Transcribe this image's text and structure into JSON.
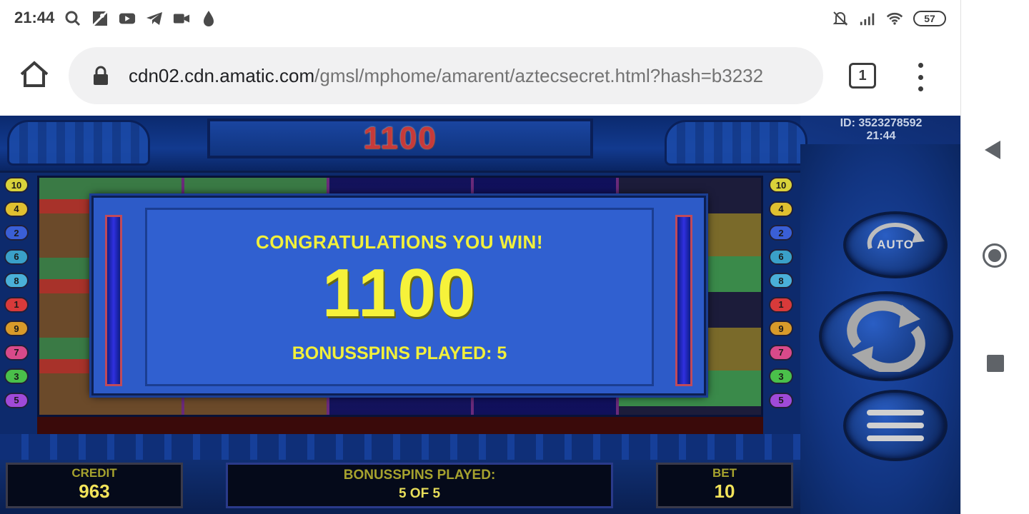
{
  "status_bar": {
    "time": "21:44",
    "notification_icons": [
      "search-icon",
      "maps-icon",
      "youtube-icon",
      "telegram-icon",
      "video-camera-icon",
      "drop-icon"
    ],
    "battery": "57"
  },
  "browser": {
    "url_host": "cdn02.cdn.amatic.com",
    "url_path": "/gmsl/mphome/amarent/aztecsecret.html?hash=b3232",
    "tab_count": "1"
  },
  "game": {
    "top_win_value": "1100",
    "session_id": "ID: 3523278592",
    "session_time": "21:44",
    "auto_label": "AUTO",
    "paylines_left": [
      "10",
      "4",
      "2",
      "6",
      "8",
      "1",
      "9",
      "7",
      "3",
      "5"
    ],
    "paylines_right": [
      "10",
      "4",
      "2",
      "6",
      "8",
      "1",
      "9",
      "7",
      "3",
      "5"
    ],
    "payline_colors": {
      "10": "#d9d23a",
      "4": "#e0c030",
      "2": "#3a5fd6",
      "6": "#3aa0c8",
      "8": "#4ab0d8",
      "1": "#d83a3a",
      "9": "#d89a2a",
      "7": "#d84a8a",
      "3": "#4ac04a",
      "5": "#a04ad8"
    },
    "popup": {
      "headline": "CONGRATULATIONS YOU WIN!",
      "amount": "1100",
      "bonus_line": "BONUSSPINS PLAYED: 5"
    },
    "credit_label": "CREDIT",
    "credit_value": "963",
    "bonus_label": "BONUSSPINS PLAYED:",
    "bonus_value": "5 OF 5",
    "bet_label": "BET",
    "bet_value": "10"
  },
  "colors": {
    "win_yellow": "#f6f23a",
    "top_win_red": "#c73a3a",
    "panel_gold": "#a6a22e"
  }
}
